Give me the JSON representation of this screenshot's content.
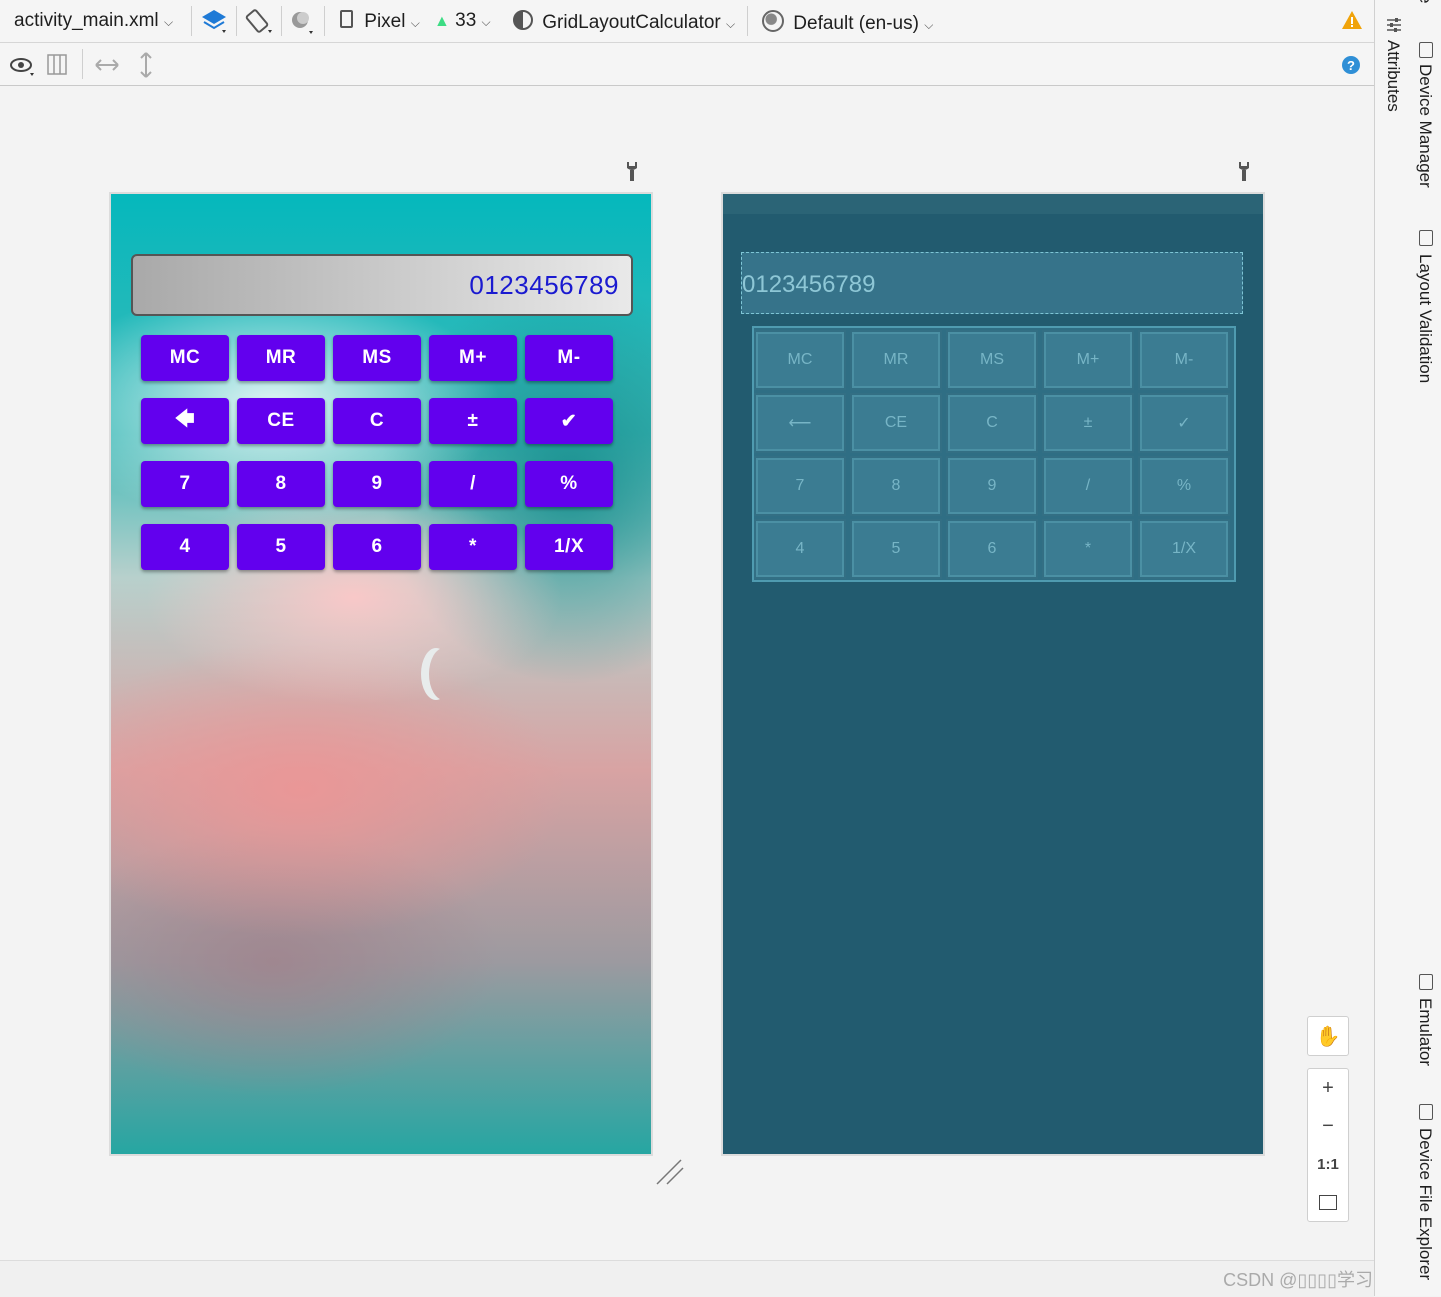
{
  "toolbar": {
    "file_name": "activity_main.xml",
    "device": "Pixel",
    "api_level": "33",
    "theme": "GridLayoutCalculator",
    "locale": "Default (en-us)"
  },
  "right_strip": {
    "attributes": "Attributes",
    "device_manager": "Device Manager",
    "layout_validation": "Layout Validation",
    "emulator": "Emulator",
    "device_file_explorer": "Device File Explorer",
    "top_cut_text": "e"
  },
  "design": {
    "display_text": "0123456789",
    "rows": [
      [
        "MC",
        "MR",
        "MS",
        "M+",
        "M-"
      ],
      [
        "🡄",
        "CE",
        "C",
        "±",
        "✔"
      ],
      [
        "7",
        "8",
        "9",
        "/",
        "%"
      ],
      [
        "4",
        "5",
        "6",
        "*",
        "1/X"
      ]
    ]
  },
  "blueprint": {
    "display_text": "0123456789",
    "rows": [
      [
        "MC",
        "MR",
        "MS",
        "M+",
        "M-"
      ],
      [
        "⟵",
        "CE",
        "C",
        "±",
        "✓"
      ],
      [
        "7",
        "8",
        "9",
        "/",
        "%"
      ],
      [
        "4",
        "5",
        "6",
        "*",
        "1/X"
      ]
    ]
  },
  "zoom": {
    "zoom_in": "+",
    "zoom_out": "−",
    "one_to_one": "1:1"
  },
  "watermark": "CSDN @▯▯▯▯学习中的猪",
  "colors": {
    "button": "#6200ee",
    "display_text": "#1a1ad0",
    "blueprint_bg": "#225b6f"
  }
}
